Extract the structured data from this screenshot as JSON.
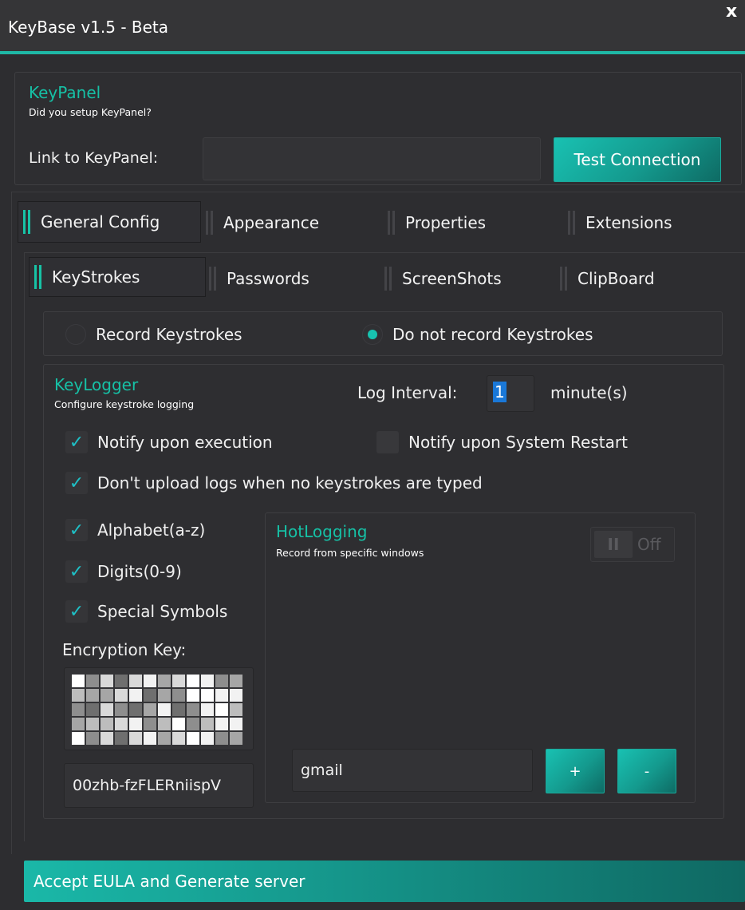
{
  "window": {
    "title": "KeyBase v1.5 - Beta",
    "close_glyph": "x"
  },
  "keypanel": {
    "title": "KeyPanel",
    "subtitle": "Did you setup KeyPanel?",
    "link_label": "Link to KeyPanel:",
    "link_value": "",
    "test_button": "Test Connection"
  },
  "main_tabs": [
    {
      "label": "General Config",
      "active": true
    },
    {
      "label": "Appearance",
      "active": false
    },
    {
      "label": "Properties",
      "active": false
    },
    {
      "label": "Extensions",
      "active": false
    }
  ],
  "sub_tabs": [
    {
      "label": "KeyStrokes",
      "active": true
    },
    {
      "label": "Passwords",
      "active": false
    },
    {
      "label": "ScreenShots",
      "active": false
    },
    {
      "label": "ClipBoard",
      "active": false
    }
  ],
  "record": {
    "option_record": "Record Keystrokes",
    "option_no_record": "Do not record Keystrokes",
    "selected": "Do not record Keystrokes"
  },
  "keylogger": {
    "title": "KeyLogger",
    "subtitle": "Configure keystroke logging",
    "log_interval_label": "Log Interval:",
    "log_interval_value": "1",
    "log_interval_unit": "minute(s)",
    "checkboxes": {
      "notify_exec": {
        "label": "Notify upon execution",
        "checked": true
      },
      "notify_restart": {
        "label": "Notify upon System Restart",
        "checked": false
      },
      "dont_upload": {
        "label": "Don't upload logs when no keystrokes are typed",
        "checked": true
      },
      "alphabet": {
        "label": "Alphabet(a-z)",
        "checked": true
      },
      "digits": {
        "label": "Digits(0-9)",
        "checked": true
      },
      "special": {
        "label": "Special Symbols",
        "checked": true
      }
    },
    "encryption_label": "Encryption Key:",
    "encryption_key": "00zhb-fzFLERniispV"
  },
  "hotlogging": {
    "title": "HotLogging",
    "subtitle": "Record from specific windows",
    "toggle_state": "Off",
    "input_value": "gmail",
    "add_label": "+",
    "remove_label": "-"
  },
  "footer": {
    "generate_button": "Accept EULA and Generate server"
  },
  "colors": {
    "accent": "#17c3a6",
    "background": "#2d2d30",
    "check": "#1ec0c6"
  }
}
